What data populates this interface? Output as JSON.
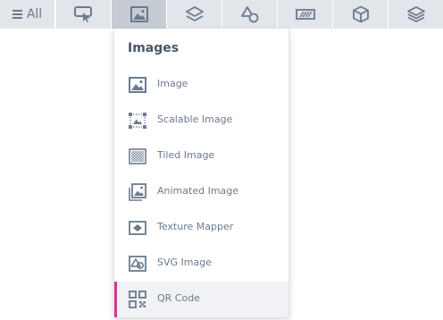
{
  "toolbar": {
    "all_label": "All",
    "active_index": 2,
    "categories": [
      {
        "icon": "menu-icon",
        "label": "All"
      },
      {
        "icon": "pointer-click-icon"
      },
      {
        "icon": "image-icon"
      },
      {
        "icon": "layers-icon"
      },
      {
        "icon": "shapes-icon"
      },
      {
        "icon": "striped-panel-icon"
      },
      {
        "icon": "cube-icon"
      },
      {
        "icon": "stack-icon"
      }
    ]
  },
  "dropdown": {
    "title": "Images",
    "items": [
      {
        "label": "Image",
        "icon": "image-icon"
      },
      {
        "label": "Scalable Image",
        "icon": "scalable-image-icon"
      },
      {
        "label": "Tiled Image",
        "icon": "tiled-image-icon"
      },
      {
        "label": "Animated Image",
        "icon": "animated-image-icon"
      },
      {
        "label": "Texture Mapper",
        "icon": "texture-mapper-icon"
      },
      {
        "label": "SVG Image",
        "icon": "svg-image-icon"
      },
      {
        "label": "QR Code",
        "icon": "qr-code-icon",
        "selected": true
      }
    ]
  },
  "colors": {
    "toolbar_bg": "#e2e5ea",
    "toolbar_active_bg": "#c7ccd4",
    "icon": "#6c7a8c",
    "selection_accent": "#cc3b8e"
  }
}
